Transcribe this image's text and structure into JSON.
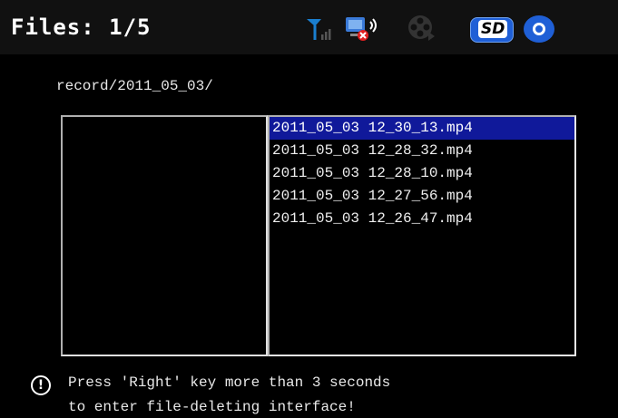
{
  "header": {
    "title": "Files: 1/5",
    "icons": [
      "antenna-signal-icon",
      "camera-muted-icon",
      "film-reel-icon",
      "sd-card-icon",
      "disc-icon"
    ],
    "sd_label": "SD"
  },
  "path": "record/2011_05_03/",
  "files": [
    "2011_05_03 12_30_13.mp4",
    "2011_05_03 12_28_32.mp4",
    "2011_05_03 12_28_10.mp4",
    "2011_05_03 12_27_56.mp4",
    "2011_05_03 12_26_47.mp4"
  ],
  "selected_index": 0,
  "hint": {
    "line1": "Press 'Right' key more than 3 seconds",
    "line2": "to enter file-deleting interface!"
  },
  "colors": {
    "selection": "#10199a",
    "accent": "#1f5fd6"
  }
}
